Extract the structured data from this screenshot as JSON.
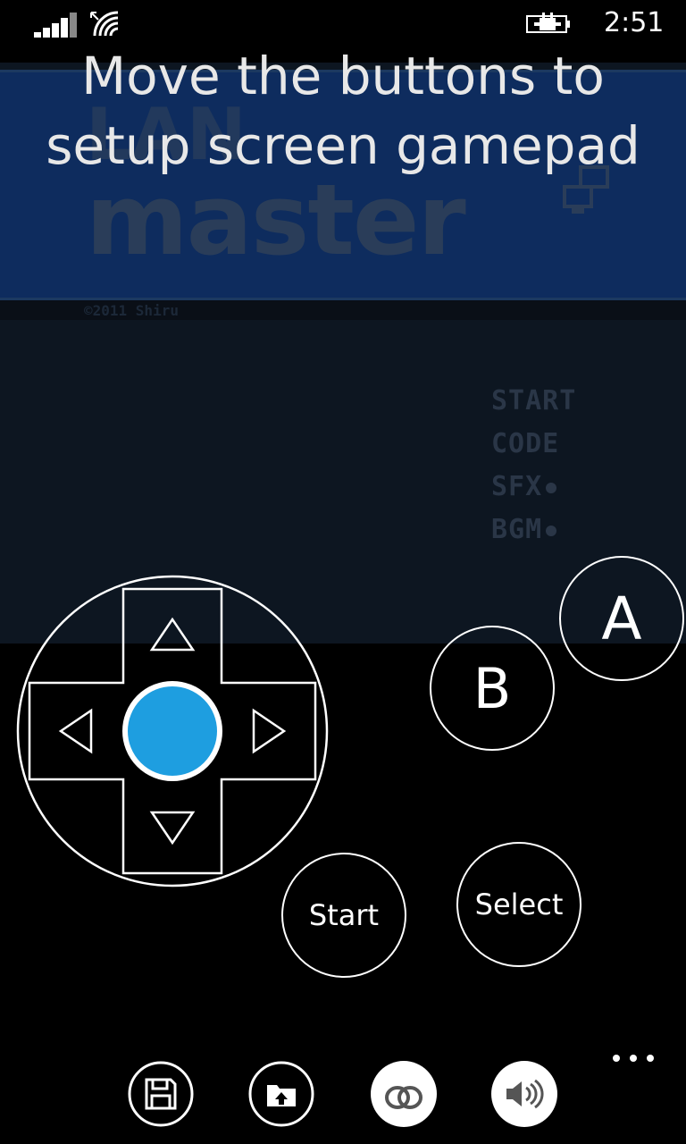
{
  "status_bar": {
    "time": "2:51",
    "signal_icon": "signal-bars-icon",
    "wifi_icon": "wifi-icon",
    "battery_icon": "battery-charging-icon"
  },
  "game": {
    "logo_top": "LAN",
    "logo_bottom": "master",
    "copyright": "©2011 Shiru",
    "menu": [
      {
        "label": "START",
        "dot": false
      },
      {
        "label": "CODE",
        "dot": false
      },
      {
        "label": "SFX",
        "dot": true
      },
      {
        "label": "BGM",
        "dot": true
      }
    ]
  },
  "instruction": {
    "line1": "Move the buttons to",
    "line2": "setup screen gamepad"
  },
  "gamepad": {
    "a_label": "A",
    "b_label": "B",
    "start_label": "Start",
    "select_label": "Select",
    "dpad_center_color": "#1e9ee0"
  },
  "app_bar": {
    "buttons": [
      {
        "icon": "save-icon"
      },
      {
        "icon": "load-state-icon"
      },
      {
        "icon": "link-cable-icon"
      },
      {
        "icon": "sound-icon"
      }
    ],
    "more_icon": "more-ellipsis-icon"
  }
}
